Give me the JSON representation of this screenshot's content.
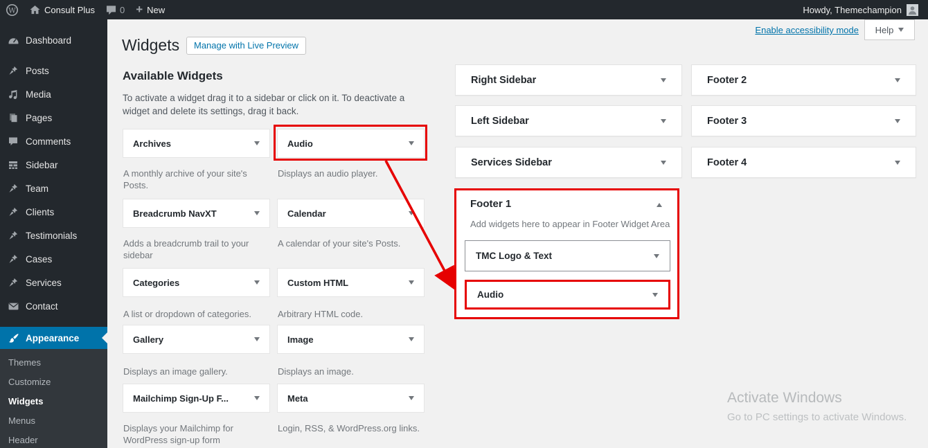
{
  "admin_bar": {
    "site_name": "Consult Plus",
    "comments_count": "0",
    "new_label": "New",
    "howdy": "Howdy, Themechampion"
  },
  "sidebar": {
    "items": [
      {
        "label": "Dashboard",
        "icon": "dashboard-icon"
      },
      {
        "label": "Posts",
        "icon": "pushpin-icon"
      },
      {
        "label": "Media",
        "icon": "media-icon"
      },
      {
        "label": "Pages",
        "icon": "pages-icon"
      },
      {
        "label": "Comments",
        "icon": "comments-icon"
      },
      {
        "label": "Sidebar",
        "icon": "layout-icon"
      },
      {
        "label": "Team",
        "icon": "pushpin-icon"
      },
      {
        "label": "Clients",
        "icon": "pushpin-icon"
      },
      {
        "label": "Testimonials",
        "icon": "pushpin-icon"
      },
      {
        "label": "Cases",
        "icon": "pushpin-icon"
      },
      {
        "label": "Services",
        "icon": "pushpin-icon"
      },
      {
        "label": "Contact",
        "icon": "envelope-icon"
      },
      {
        "label": "Appearance",
        "icon": "paintbrush-icon"
      }
    ],
    "active_item": "Appearance",
    "submenu": [
      "Themes",
      "Customize",
      "Widgets",
      "Menus",
      "Header"
    ],
    "active_submenu": "Widgets"
  },
  "header": {
    "title": "Widgets",
    "manage_button": "Manage with Live Preview",
    "accessibility_link": "Enable accessibility mode",
    "help_label": "Help"
  },
  "available_widgets": {
    "heading": "Available Widgets",
    "description": "To activate a widget drag it to a sidebar or click on it. To deactivate a widget and delete its settings, drag it back.",
    "widgets": [
      {
        "name": "Archives",
        "desc": "A monthly archive of your site's Posts."
      },
      {
        "name": "Audio",
        "desc": "Displays an audio player.",
        "highlighted": true
      },
      {
        "name": "Breadcrumb NavXT",
        "desc": "Adds a breadcrumb trail to your sidebar"
      },
      {
        "name": "Calendar",
        "desc": "A calendar of your site's Posts."
      },
      {
        "name": "Categories",
        "desc": "A list or dropdown of categories."
      },
      {
        "name": "Custom HTML",
        "desc": "Arbitrary HTML code."
      },
      {
        "name": "Gallery",
        "desc": "Displays an image gallery."
      },
      {
        "name": "Image",
        "desc": "Displays an image."
      },
      {
        "name": "Mailchimp Sign-Up F...",
        "desc": "Displays your Mailchimp for WordPress sign-up form"
      },
      {
        "name": "Meta",
        "desc": "Login, RSS, & WordPress.org links."
      }
    ]
  },
  "widget_areas": {
    "column1": [
      {
        "name": "Right Sidebar"
      },
      {
        "name": "Left Sidebar"
      },
      {
        "name": "Services Sidebar"
      }
    ],
    "column2": [
      {
        "name": "Footer 2"
      },
      {
        "name": "Footer 3"
      },
      {
        "name": "Footer 4"
      }
    ],
    "footer1": {
      "title": "Footer 1",
      "description": "Add widgets here to appear in Footer Widget Area",
      "widgets": [
        {
          "name": "TMC Logo & Text"
        },
        {
          "name": "Audio",
          "highlighted": true
        }
      ]
    }
  },
  "watermark": {
    "line1": "Activate Windows",
    "line2": "Go to PC settings to activate Windows."
  },
  "colors": {
    "accent": "#0073aa",
    "red": "#e60000",
    "bar-bg": "#23282d",
    "page-bg": "#f1f1f1"
  }
}
